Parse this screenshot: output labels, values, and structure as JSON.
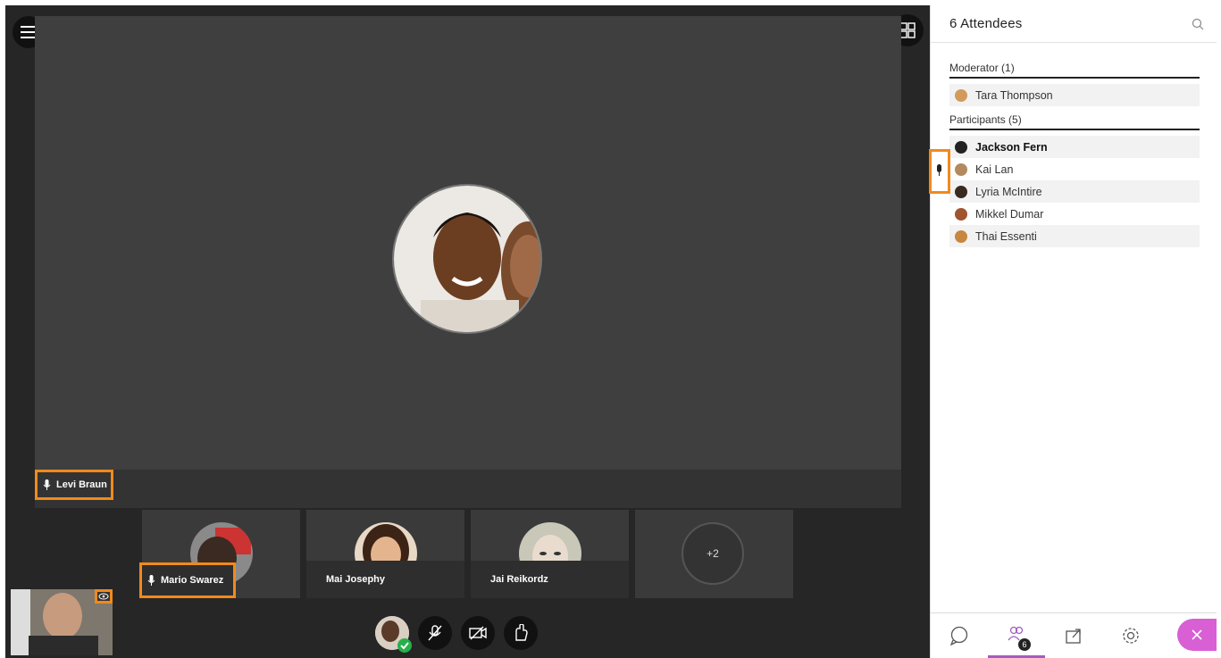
{
  "app": {
    "attendees_title": "6 Attendees",
    "menu_icon": "hamburger-menu-icon",
    "layout_icon": "grid-layout-icon"
  },
  "stage": {
    "active_speaker": "Levi Braun",
    "tiles": [
      {
        "name": "Mario Swarez"
      },
      {
        "name": "Mai Josephy"
      },
      {
        "name": "Jai Reikordz"
      }
    ],
    "more_count": "+2"
  },
  "panel": {
    "moderators_header": "Moderator (1)",
    "moderators": [
      {
        "name": "Tara Thompson"
      }
    ],
    "participants_header": "Participants (5)",
    "participants": [
      {
        "name": "Jackson Fern"
      },
      {
        "name": "Kai Lan"
      },
      {
        "name": "Lyria McIntire"
      },
      {
        "name": "Mikkel Dumar"
      },
      {
        "name": "Thai Essenti"
      }
    ],
    "attendee_badge": "6"
  },
  "colors": {
    "highlight": "#f08a1c",
    "accent": "#a45cbf",
    "close": "#d85fd4",
    "online": "#27b04a"
  }
}
